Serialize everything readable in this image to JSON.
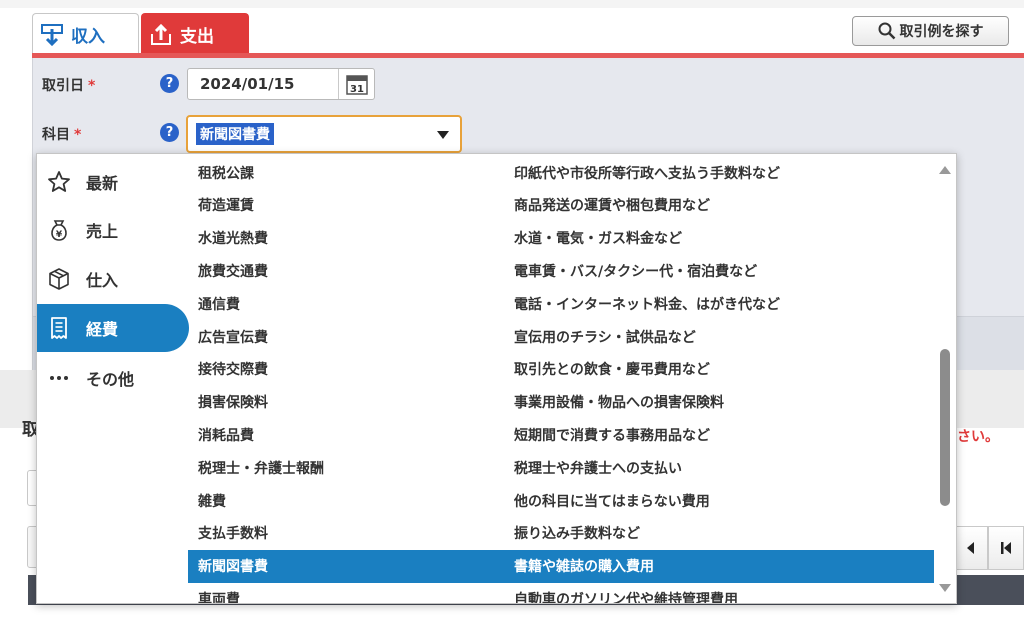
{
  "tabs": {
    "income_label": "収入",
    "expense_label": "支出"
  },
  "find_button": {
    "label": "取引例を探す"
  },
  "form": {
    "date_label": "取引日",
    "date_value": "2024/01/15",
    "subject_label": "科目",
    "subject_value": "新聞図書費",
    "required_mark": "*",
    "help_glyph": "?"
  },
  "categories": [
    {
      "label": "最新",
      "icon": "star-icon",
      "active": false
    },
    {
      "label": "売上",
      "icon": "money-bag-icon",
      "active": false
    },
    {
      "label": "仕入",
      "icon": "box-icon",
      "active": false
    },
    {
      "label": "経費",
      "icon": "receipt-icon",
      "active": true
    },
    {
      "label": "その他",
      "icon": "more-icon",
      "active": false
    }
  ],
  "accounts": [
    {
      "name": "租税公課",
      "desc": "印紙代や市役所等行政へ支払う手数料など"
    },
    {
      "name": "荷造運賃",
      "desc": "商品発送の運賃や梱包費用など"
    },
    {
      "name": "水道光熱費",
      "desc": "水道・電気・ガス料金など"
    },
    {
      "name": "旅費交通費",
      "desc": "電車賃・バス/タクシー代・宿泊費など"
    },
    {
      "name": "通信費",
      "desc": "電話・インターネット料金、はがき代など"
    },
    {
      "name": "広告宣伝費",
      "desc": "宣伝用のチラシ・試供品など"
    },
    {
      "name": "接待交際費",
      "desc": "取引先との飲食・慶弔費用など"
    },
    {
      "name": "損害保険料",
      "desc": "事業用設備・物品への損害保険料"
    },
    {
      "name": "消耗品費",
      "desc": "短期間で消費する事務用品など"
    },
    {
      "name": "税理士・弁護士報酬",
      "desc": "税理士や弁護士への支払い"
    },
    {
      "name": "雑費",
      "desc": "他の科目に当てはまらない費用"
    },
    {
      "name": "支払手数料",
      "desc": "振り込み手数料など"
    },
    {
      "name": "新聞図書費",
      "desc": "書籍や雑誌の購入費用",
      "selected": true
    },
    {
      "name": "車両費",
      "desc": "自動車のガソリン代や維持管理費用"
    }
  ],
  "background": {
    "section_label_fragment": "取",
    "note_fragment": "さい。"
  },
  "colors": {
    "accent_blue": "#1a7fc1",
    "expense_red": "#e03a3a",
    "focus_orange": "#e8a23a"
  }
}
